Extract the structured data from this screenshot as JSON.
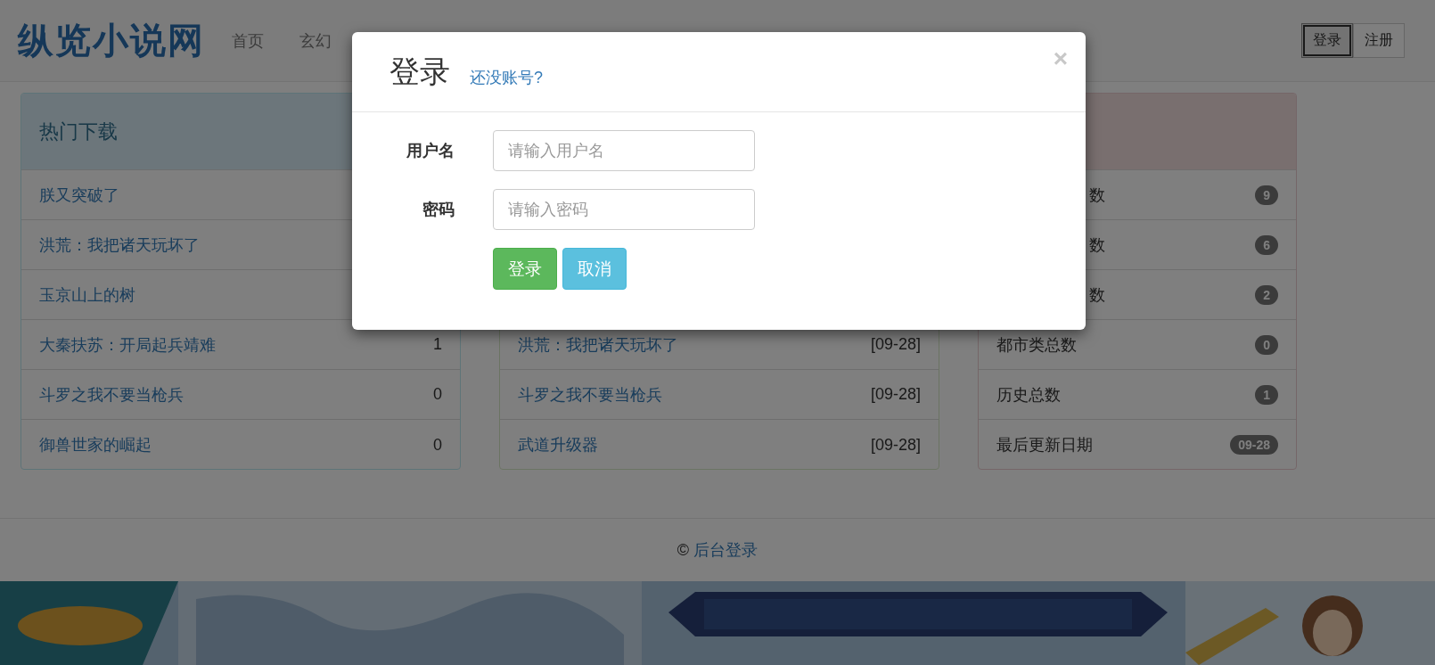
{
  "navbar": {
    "logo": "纵览小说网",
    "links": [
      {
        "label": "首页",
        "selected": false
      },
      {
        "label": "玄幻",
        "selected": false
      }
    ],
    "buttons": [
      {
        "label": "登录",
        "focused": true
      },
      {
        "label": "注册",
        "focused": false
      }
    ]
  },
  "panels": [
    {
      "kind": "hot",
      "title": "热门下载",
      "rows": [
        {
          "name": "朕又突破了"
        },
        {
          "name": "洪荒：我把诸天玩坏了"
        },
        {
          "name": "玉京山上的树"
        },
        {
          "name": "大秦扶苏：开局起兵靖难",
          "value": "1"
        },
        {
          "name": "斗罗之我不要当枪兵",
          "value": "0"
        },
        {
          "name": "御兽世家的崛起",
          "value": "0"
        }
      ]
    },
    {
      "kind": "updates",
      "rows": [
        {
          "name": "洪荒：我把诸天玩坏了",
          "value": "[09-28]"
        },
        {
          "name": "斗罗之我不要当枪兵",
          "value": "[09-28]"
        },
        {
          "name": "武道升级器",
          "value": "[09-28]"
        }
      ]
    },
    {
      "kind": "stats",
      "rows": [
        {
          "name": "数",
          "covered": true,
          "value": "9"
        },
        {
          "name": "数",
          "covered": true,
          "value": "6"
        },
        {
          "name": "数",
          "covered": true,
          "value": "2"
        },
        {
          "name": "都市类总数",
          "value": "0"
        },
        {
          "name": "历史总数",
          "value": "1"
        },
        {
          "name": "最后更新日期",
          "value": "09-28"
        }
      ]
    }
  ],
  "footer": {
    "copyright": "©",
    "link": "后台登录"
  },
  "modal": {
    "title": "登录",
    "signup_link": "还没账号?",
    "close": "×",
    "fields": [
      {
        "label": "用户名",
        "placeholder": "请输入用户名"
      },
      {
        "label": "密码",
        "placeholder": "请输入密码"
      }
    ],
    "buttons": [
      {
        "label": "登录",
        "kind": "primary"
      },
      {
        "label": "取消",
        "kind": "cancel"
      }
    ]
  }
}
